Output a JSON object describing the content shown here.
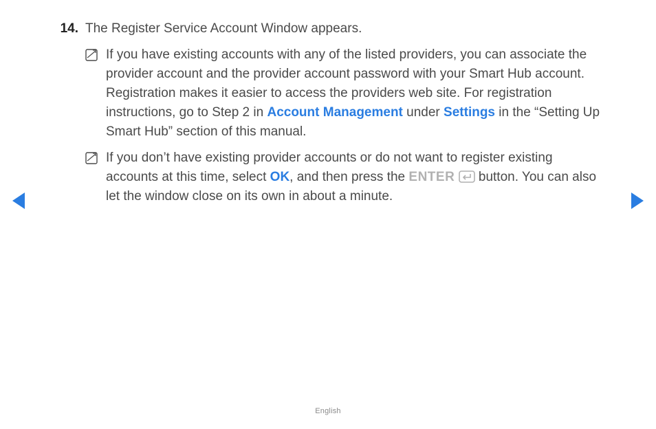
{
  "step": {
    "number": "14.",
    "title": "The Register Service Account Window appears."
  },
  "notes": [
    {
      "pre": "If you have existing accounts with any of the listed providers, you can associate the provider account and the provider account password with your Smart Hub account.",
      "line2a": "Registration makes it easier to access the providers web site. For registration instructions, go to Step 2 in ",
      "link1": "Account Management",
      "mid1": " under ",
      "link2": "Settings",
      "tail": " in the “Setting Up Smart Hub” section of this manual."
    },
    {
      "a": "If you don’t have existing provider accounts or do not want to register existing accounts at this time, select ",
      "ok": "OK",
      "b": ", and then press the ",
      "enter": "ENTER",
      "c": " button. You can also let the window close on its own in about a minute."
    }
  ],
  "footer": {
    "language": "English"
  }
}
